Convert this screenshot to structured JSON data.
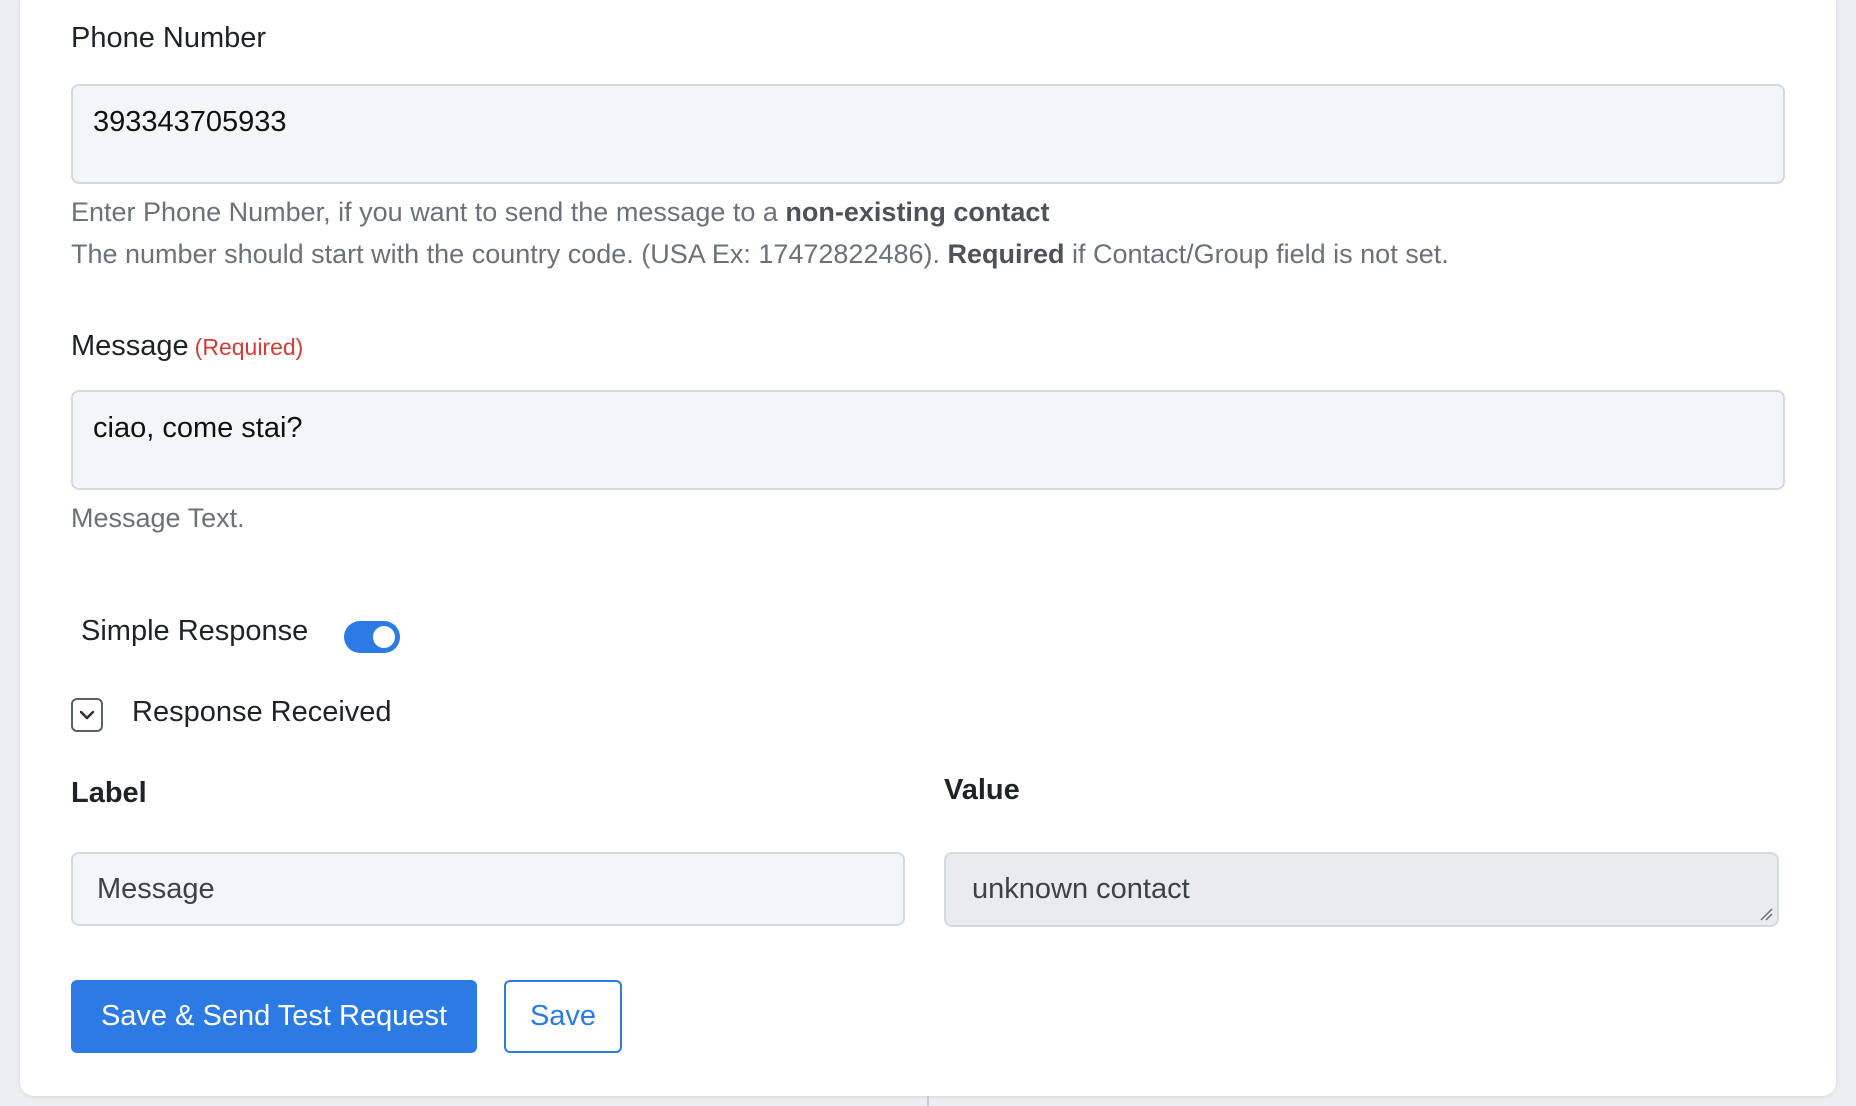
{
  "phone": {
    "label": "Phone Number",
    "value": "393343705933",
    "help_line1_prefix": "Enter Phone Number, if you want to send the message to a ",
    "help_line1_bold": "non-existing contact",
    "help_line2_prefix": "The number should start with the country code. (USA Ex: 17472822486). ",
    "help_line2_bold": "Required",
    "help_line2_suffix": " if Contact/Group field is not set."
  },
  "message": {
    "label": "Message",
    "required": "(Required)",
    "value": "ciao, come stai?",
    "help": "Message Text."
  },
  "simple_response": {
    "label": "Simple Response",
    "enabled": true
  },
  "response_received": {
    "label": "Response Received"
  },
  "mapping": {
    "label_header": "Label",
    "value_header": "Value",
    "label_value": "Message",
    "value_value": "unknown contact"
  },
  "buttons": {
    "save_send": "Save & Send Test Request",
    "save": "Save"
  },
  "colors": {
    "accent": "#2c7be5",
    "required": "#d23b3b"
  }
}
